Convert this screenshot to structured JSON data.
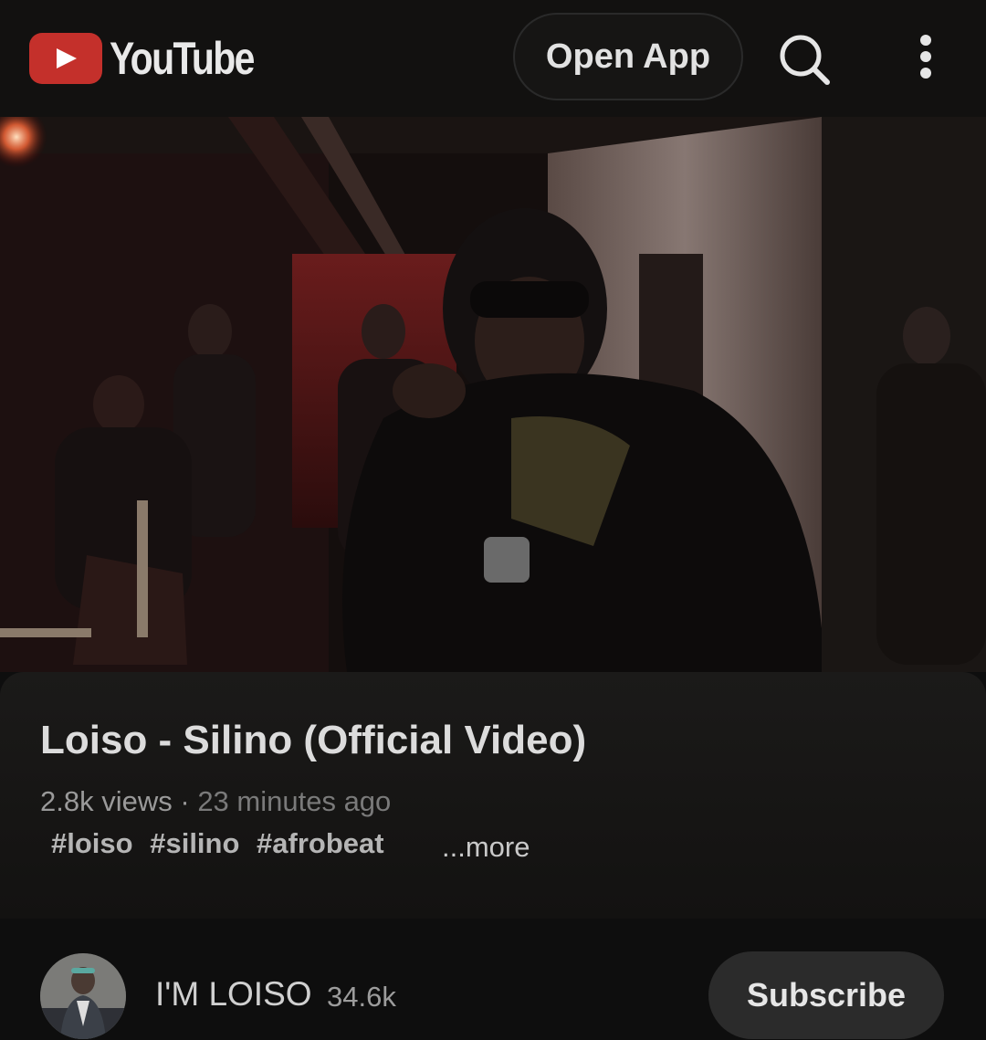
{
  "header": {
    "brand": "YouTube",
    "open_app_label": "Open App",
    "icons": [
      "youtube-logo-icon",
      "search-icon",
      "more-vert-icon"
    ],
    "colors": {
      "brand_red": "#c4302b",
      "background": "#0f0f0f"
    }
  },
  "video": {
    "title": "Loiso - Silino (Official Video)",
    "views": "2.8k views",
    "separator": "·",
    "uploaded": "23 minutes ago",
    "tags": [
      "#loiso",
      "#silino",
      "#afrobeat"
    ],
    "more_label": "...more"
  },
  "channel": {
    "name": "I'M LOISO",
    "subscribers": "34.6k",
    "subscribe_label": "Subscribe"
  }
}
